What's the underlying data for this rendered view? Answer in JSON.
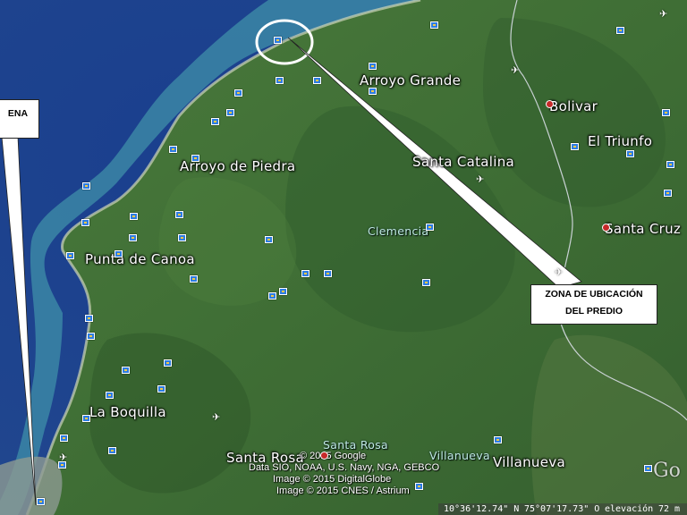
{
  "places": {
    "arroyo_grande": "Arroyo Grande",
    "bolivar": "Bolivar",
    "el_triunfo": "El Triunfo",
    "santa_catalina": "Santa Catalina",
    "arroyo_de_piedra": "Arroyo de Piedra",
    "clemencia": "Clemencia",
    "santa_cruz": "Santa Cruz",
    "punta_de_canoa": "Punta de Canoa",
    "la_boquilla": "La Boquilla",
    "santa_rosa": "Santa Rosa",
    "santa_rosa_small": "Santa Rosa",
    "villanueva": "Villanueva",
    "villanueva_small": "Villanueva"
  },
  "callouts": {
    "left_partial": "ENA",
    "zone_line1": "ZONA DE UBICACIÓN",
    "zone_line2": "DEL PREDIO"
  },
  "copyright": {
    "line1": "© 2015 Google",
    "line2": "Data SIO, NOAA, U.S. Navy, NGA, GEBCO",
    "line3": "Image © 2015 DigitalGlobe",
    "line4": "Image © 2015 CNES / Astrium"
  },
  "status": {
    "lat": "10°36'12.74\" N",
    "lon": "75°07'17.73\" O",
    "elev_label": "elevación",
    "elev_value": "72 m"
  },
  "brand": "Go",
  "colors": {
    "ocean_deep": "#1e3f86",
    "ocean_shallow": "#3f8fa0",
    "land": "#3d6b35",
    "land_dark": "#2f5a2c",
    "border_line": "#d8dde6",
    "callout_bg": "#ffffff"
  },
  "icons": [
    "photo-icon",
    "airport-icon",
    "place-pin-icon",
    "selection-circle"
  ]
}
